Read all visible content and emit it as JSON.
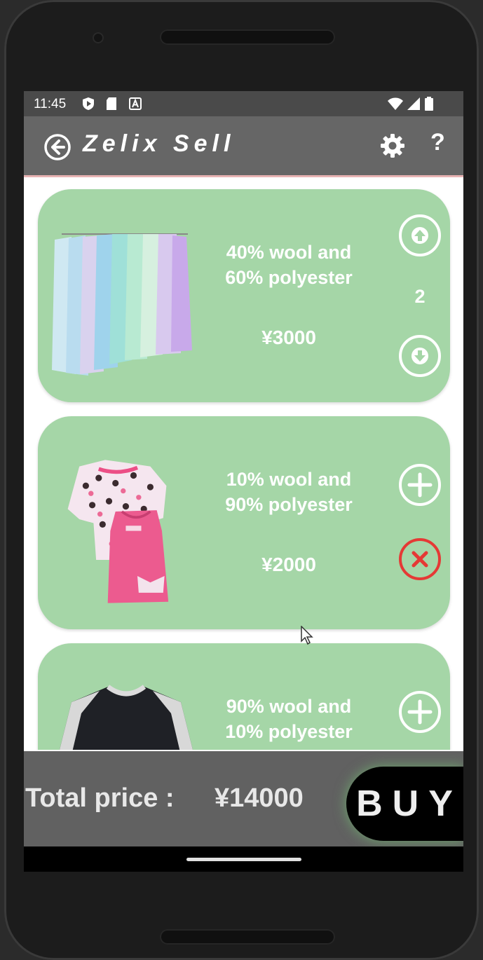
{
  "status": {
    "time": "11:45"
  },
  "appbar": {
    "title": "Zelix Sell",
    "help_label": "?"
  },
  "items": [
    {
      "description": "40% wool and\n60% polyester",
      "price": "¥3000",
      "quantity": "2",
      "controls": [
        "arrow-up-icon",
        "arrow-down-icon"
      ]
    },
    {
      "description": "10% wool and\n90% polyester",
      "price": "¥2000",
      "controls": [
        "plus-icon",
        "close-icon"
      ]
    },
    {
      "description": "90% wool and\n10% polyester",
      "price": "",
      "controls": [
        "plus-icon"
      ]
    }
  ],
  "footer": {
    "total_label": "Total price :",
    "total_value": "¥14000",
    "buy_label": "BUY"
  },
  "colors": {
    "card": "#a5d6a7",
    "appbar": "#666666",
    "remove": "#e53935",
    "buy": "#000000"
  }
}
